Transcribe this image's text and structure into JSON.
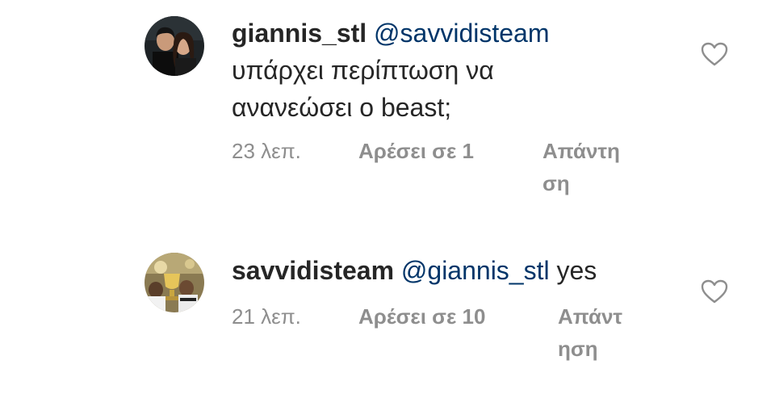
{
  "comments": [
    {
      "username": "giannis_stl",
      "mention": "@savvidisteam",
      "text_line1": "υπάρχει περίπτωση να",
      "text_line2": "ανανεώσει ο beast;",
      "time": "23 λεπ.",
      "likes": "Αρέσει σε 1",
      "reply_line1": "Απάντη",
      "reply_line2": "ση",
      "avatar_icon": "couple-photo-avatar",
      "heart_icon": "heart-outline-icon"
    },
    {
      "username": "savvidisteam",
      "mention": "@giannis_stl",
      "text": "yes",
      "time": "21 λεπ.",
      "likes": "Αρέσει σε 10",
      "reply_line1": "Απάντ",
      "reply_line2": "ηση",
      "avatar_icon": "trophy-photo-avatar",
      "heart_icon": "heart-outline-icon"
    }
  ],
  "colors": {
    "text": "#262626",
    "mention": "#003569",
    "meta": "#8e8e8e",
    "background": "#ffffff"
  }
}
